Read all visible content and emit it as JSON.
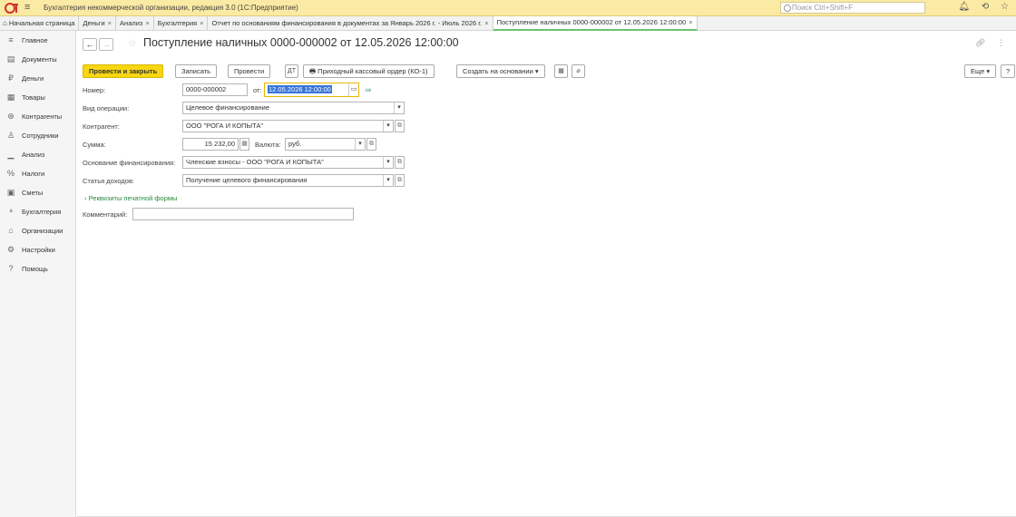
{
  "app": {
    "title": "Бухгалтерия некоммерческой организации, редакция 3.0  (1С:Предприятие)",
    "search_placeholder": "Поиск Ctrl+Shift+F"
  },
  "tabs": [
    {
      "label": "Начальная страница",
      "closable": false
    },
    {
      "label": "Деньги",
      "closable": true
    },
    {
      "label": "Анализ",
      "closable": true
    },
    {
      "label": "Бухгалтерия",
      "closable": true
    },
    {
      "label": "Отчет по основаниям финансирования в документах за Январь 2026 г. - Июль 2026 г.",
      "closable": true
    },
    {
      "label": "Поступление наличных 0000-000002 от 12.05.2026 12:00:00",
      "closable": true,
      "active": true
    }
  ],
  "tab_close_glyph": "×",
  "sidebar": {
    "items": [
      {
        "label": "Главное",
        "icon": "≡"
      },
      {
        "label": "Документы",
        "icon": "▤"
      },
      {
        "label": "Деньги",
        "icon": "₽"
      },
      {
        "label": "Товары",
        "icon": "▦"
      },
      {
        "label": "Контрагенты",
        "icon": "⊛"
      },
      {
        "label": "Сотрудники",
        "icon": "♙"
      },
      {
        "label": "Анализ",
        "icon": "▁"
      },
      {
        "label": "Налоги",
        "icon": "%"
      },
      {
        "label": "Сметы",
        "icon": "▣"
      },
      {
        "label": "Бухгалтерия",
        "icon": "ᵃ"
      },
      {
        "label": "Организации",
        "icon": "⌂"
      },
      {
        "label": "Настройки",
        "icon": "⚙"
      },
      {
        "label": "Помощь",
        "icon": "?"
      }
    ]
  },
  "document": {
    "title": "Поступление наличных 0000-000002 от 12.05.2026 12:00:00"
  },
  "toolbar": {
    "post_and_close": "Провести и закрыть",
    "save": "Записать",
    "post": "Провести",
    "print_order": "Приходный кассовый ордер (КО-1)",
    "create_based_on": "Создать на основании",
    "more": "Еще",
    "help": "?"
  },
  "form": {
    "number_label": "Номер:",
    "number_value": "0000-000002",
    "date_label": "от:",
    "date_value": "12.05.2026 12:00:00",
    "operation_label": "Вид операции:",
    "operation_value": "Целевое финансирование",
    "counterparty_label": "Контрагент:",
    "counterparty_value": "ООО \"РОГА И КОПЫТА\"",
    "amount_label": "Сумма:",
    "amount_value": "15 232,00",
    "currency_label": "Валюта:",
    "currency_value": "руб.",
    "basis_label": "Основание финансирования:",
    "basis_value": "Членские взносы - ООО \"РОГА И КОПЫТА\"",
    "income_label": "Статья доходов:",
    "income_value": "Получение целевого финансирования",
    "print_details": "Реквизиты печатной формы",
    "comment_label": "Комментарий:",
    "comment_value": ""
  }
}
